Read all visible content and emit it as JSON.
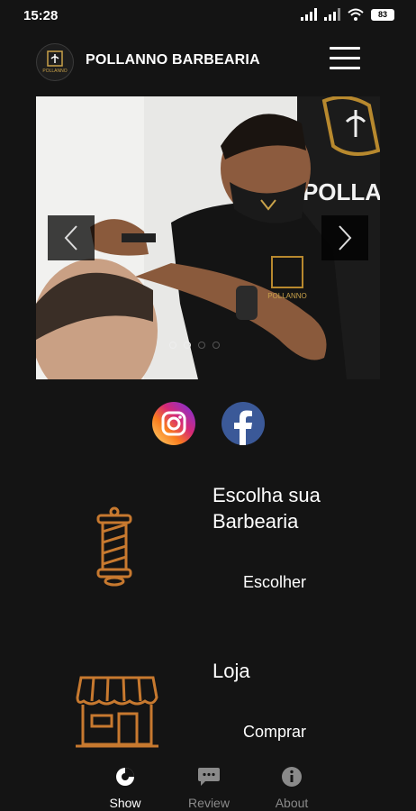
{
  "status": {
    "time": "15:28",
    "battery": "83"
  },
  "header": {
    "title": "POLLANNO BARBEARIA",
    "logo_text": "POLLANNO"
  },
  "carousel": {
    "slide_count": 4,
    "active_index": 0,
    "prev_icon": "chevron-left-icon",
    "next_icon": "chevron-right-icon",
    "photo_text": "POLLANNO",
    "sign_text": "POLLA"
  },
  "social": {
    "instagram_icon": "instagram-icon",
    "facebook_icon": "facebook-icon"
  },
  "cards": [
    {
      "title_line1": "Escolha sua",
      "title_line2": "Barbearia",
      "action": "Escolher",
      "icon": "barber-pole-icon"
    },
    {
      "title_line1": "Loja",
      "action": "Comprar",
      "icon": "storefront-icon"
    }
  ],
  "bottom_nav": [
    {
      "label": "Show",
      "icon": "show-icon",
      "active": true
    },
    {
      "label": "Review",
      "icon": "chat-icon",
      "active": false
    },
    {
      "label": "About",
      "icon": "info-icon",
      "active": false
    }
  ],
  "colors": {
    "accent": "#c7792f",
    "background": "#141414",
    "inactive": "#8a8a8a"
  }
}
